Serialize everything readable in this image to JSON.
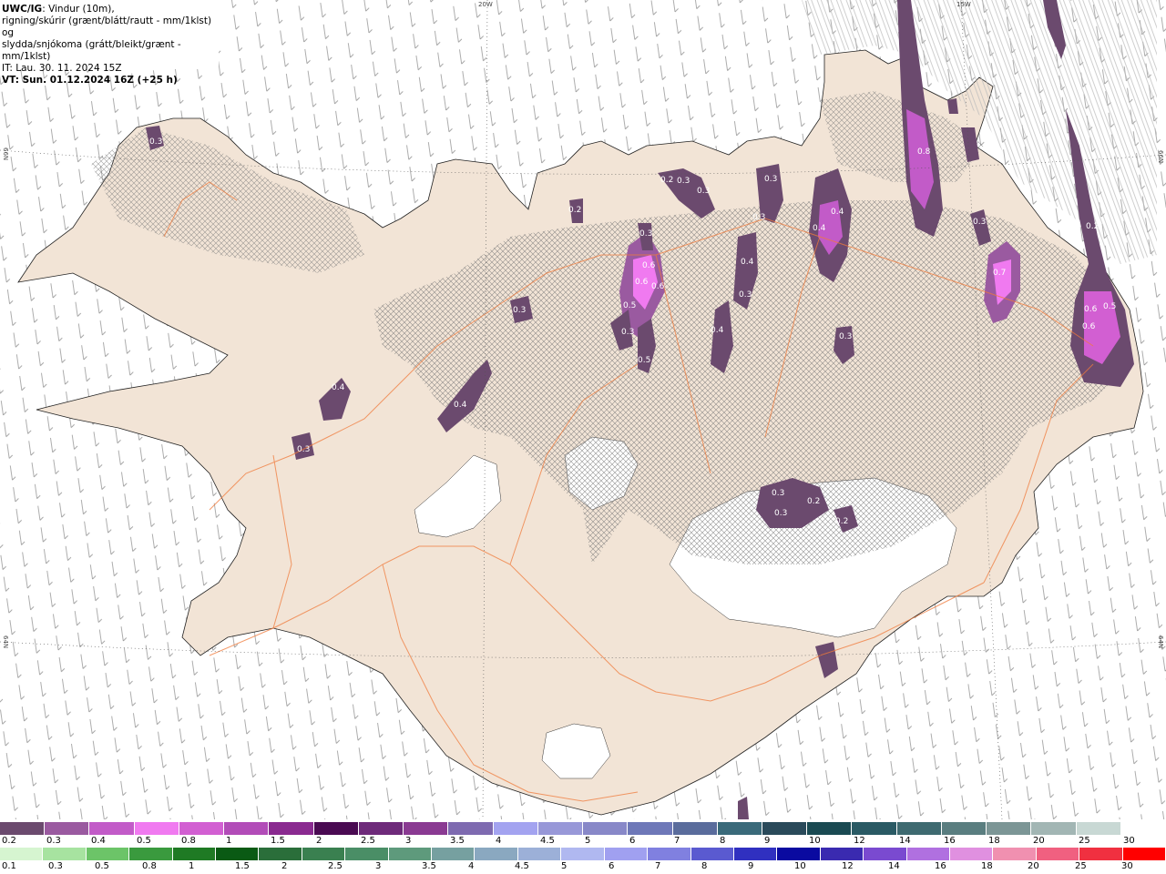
{
  "header": {
    "model": "UWC/IG",
    "line1_rest": ": Vindur (10m),",
    "line2": "rigning/skúrir (grænt/blátt/rautt - mm/1klst) og",
    "line3": "slydda/snjókoma (grátt/bleikt/grænt - mm/1klst)",
    "line4": "IT: Lau. 30. 11. 2024 15Z",
    "line5": "VT: Sun. 01.12.2024 16Z (+25 h)"
  },
  "coords": {
    "top_20w": "20W",
    "top_15w": "15W",
    "left_66n": "66N",
    "left_64n": "64N",
    "right_66n": "66N",
    "right_64n": "64N"
  },
  "precip_labels": [
    {
      "text": "0.3"
    },
    {
      "text": "0.2"
    },
    {
      "text": "0.3"
    },
    {
      "text": "0.3"
    },
    {
      "text": "0.3"
    },
    {
      "text": "0.3"
    },
    {
      "text": "0.2"
    },
    {
      "text": "0.3"
    },
    {
      "text": "0.6"
    },
    {
      "text": "0.6"
    },
    {
      "text": "0.6"
    },
    {
      "text": "0.5"
    },
    {
      "text": "0.3"
    },
    {
      "text": "0.5"
    },
    {
      "text": "0.4"
    },
    {
      "text": "0.3"
    },
    {
      "text": "0.4"
    },
    {
      "text": "0.4"
    },
    {
      "text": "0.4"
    },
    {
      "text": "0.8"
    },
    {
      "text": "0.3"
    },
    {
      "text": "0.7"
    },
    {
      "text": "0.6"
    },
    {
      "text": "0.5"
    },
    {
      "text": "0.2"
    },
    {
      "text": "0.6"
    },
    {
      "text": "0.4"
    },
    {
      "text": "0.4"
    },
    {
      "text": "0.3"
    },
    {
      "text": "0.3"
    },
    {
      "text": "0.3"
    },
    {
      "text": "0.3"
    },
    {
      "text": "0.2"
    },
    {
      "text": "0.3"
    },
    {
      "text": "0.2"
    }
  ],
  "legend_snow": {
    "colors": [
      "#6b4a6e",
      "#9a5aa0",
      "#c25bc8",
      "#f07af0",
      "#d25fd2",
      "#b24cb8",
      "#8a2a90",
      "#4a0a52",
      "#6e2a7a",
      "#8a3a92",
      "#7e6ab0",
      "#a3a3f0",
      "#9898d8",
      "#8888c8",
      "#6e78b8",
      "#5a6c9c",
      "#3a6a7a",
      "#2a4a5a",
      "#1a4a52",
      "#2a5a64",
      "#3e6a70",
      "#5a7e80",
      "#7c9696",
      "#a2b6b4",
      "#c8d8d4",
      "#ffffff"
    ],
    "labels": [
      "0.2",
      "0.3",
      "0.4",
      "0.5",
      "0.8",
      "1",
      "1.5",
      "2",
      "2.5",
      "3",
      "3.5",
      "4",
      "4.5",
      "5",
      "6",
      "7",
      "8",
      "9",
      "10",
      "12",
      "14",
      "16",
      "18",
      "20",
      "25",
      "30"
    ]
  },
  "legend_rain": {
    "colors": [
      "#d6f5d0",
      "#a7e3a0",
      "#6cc468",
      "#3a9a3e",
      "#1f7a24",
      "#0a5a14",
      "#2a6e3a",
      "#3a8050",
      "#4a8e66",
      "#5e9a7c",
      "#76a0a0",
      "#8aa8c0",
      "#9cb0d8",
      "#b0b8f0",
      "#a0a0f0",
      "#8080e0",
      "#5a5ad0",
      "#3030c0",
      "#0a0aa0",
      "#3a2ab0",
      "#7a4ad0",
      "#b070e0",
      "#e090e0",
      "#f090b0",
      "#f06080",
      "#f03040",
      "#ff0000"
    ],
    "labels": [
      "0.1",
      "0.3",
      "0.5",
      "0.8",
      "1",
      "1.5",
      "2",
      "2.5",
      "3",
      "3.5",
      "4",
      "4.5",
      "5",
      "6",
      "7",
      "8",
      "9",
      "10",
      "12",
      "14",
      "16",
      "18",
      "20",
      "25",
      "30"
    ]
  }
}
